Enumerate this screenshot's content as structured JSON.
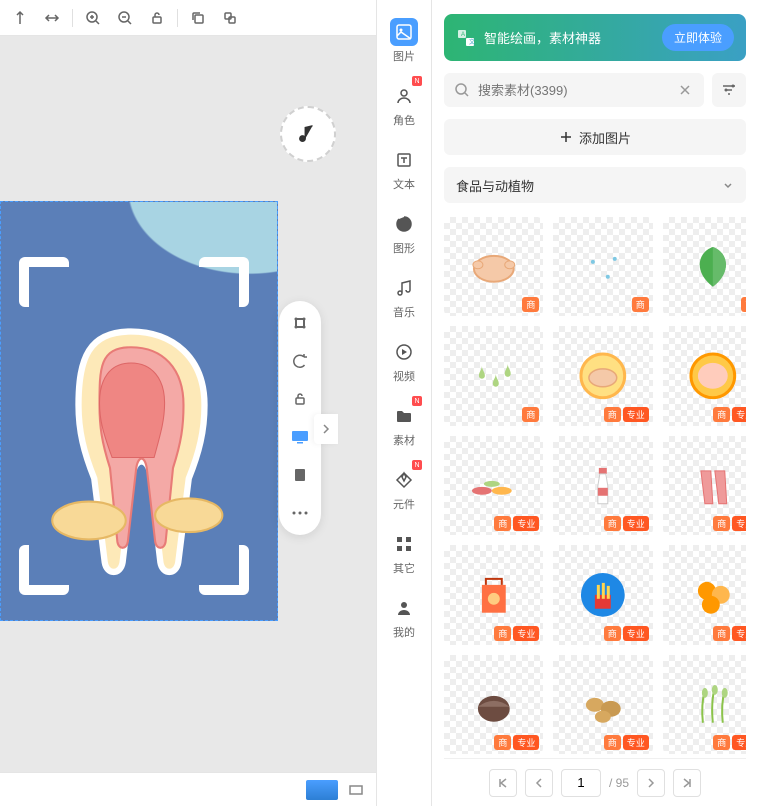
{
  "toolbar": {
    "icons": [
      "align-vertical",
      "align-horizontal",
      "zoom-in",
      "zoom-out",
      "lock-open",
      "sep",
      "copy",
      "duplicate"
    ]
  },
  "sidebar": {
    "items": [
      {
        "label": "图片",
        "icon": "image",
        "active": true
      },
      {
        "label": "角色",
        "icon": "user",
        "badge": "N"
      },
      {
        "label": "文本",
        "icon": "text"
      },
      {
        "label": "图形",
        "icon": "shape"
      },
      {
        "label": "音乐",
        "icon": "music"
      },
      {
        "label": "视频",
        "icon": "video"
      },
      {
        "label": "素材",
        "icon": "folder",
        "badge": "N"
      },
      {
        "label": "元件",
        "icon": "component",
        "badge": "N"
      },
      {
        "label": "其它",
        "icon": "grid"
      },
      {
        "label": "我的",
        "icon": "person"
      }
    ]
  },
  "banner": {
    "text": "智能绘画，素材神器",
    "btn": "立即体验"
  },
  "search": {
    "placeholder": "搜索素材(3399)"
  },
  "add_label": "添加图片",
  "category": "食品与动植物",
  "assets": [
    {
      "tags": [
        "商"
      ],
      "shape": "chicken"
    },
    {
      "tags": [
        "商"
      ],
      "shape": "dots"
    },
    {
      "tags": [
        "商"
      ],
      "shape": "leaf"
    },
    {
      "tags": [
        "商"
      ],
      "shape": "drops"
    },
    {
      "tags": [
        "商",
        "专业"
      ],
      "shape": "chicken-circle"
    },
    {
      "tags": [
        "商",
        "专业"
      ],
      "shape": "patty"
    },
    {
      "tags": [
        "商",
        "专业"
      ],
      "shape": "plates"
    },
    {
      "tags": [
        "商",
        "专业"
      ],
      "shape": "bottle"
    },
    {
      "tags": [
        "商",
        "专业"
      ],
      "shape": "meat"
    },
    {
      "tags": [
        "商",
        "专业"
      ],
      "shape": "bag"
    },
    {
      "tags": [
        "商",
        "专业"
      ],
      "shape": "fries"
    },
    {
      "tags": [
        "商",
        "专业"
      ],
      "shape": "biscuits"
    },
    {
      "tags": [
        "商",
        "专业"
      ],
      "shape": "nut"
    },
    {
      "tags": [
        "商",
        "专业"
      ],
      "shape": "potatoes"
    },
    {
      "tags": [
        "商",
        "专业"
      ],
      "shape": "wheat"
    }
  ],
  "pagination": {
    "current": "1",
    "total": "/ 95"
  }
}
